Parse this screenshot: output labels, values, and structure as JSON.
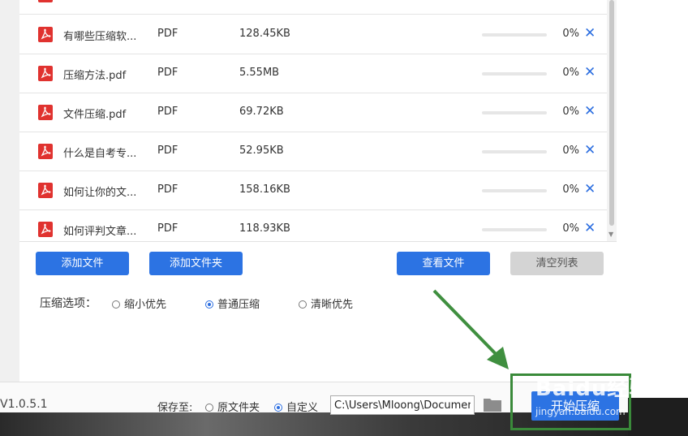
{
  "files": [
    {
      "name": "有哪些压缩软...",
      "type": "PDF",
      "size": "128.45KB",
      "progress": 0,
      "percent": "0%"
    },
    {
      "name": "压缩方法.pdf",
      "type": "PDF",
      "size": "5.55MB",
      "progress": 0,
      "percent": "0%"
    },
    {
      "name": "文件压缩.pdf",
      "type": "PDF",
      "size": "69.72KB",
      "progress": 0,
      "percent": "0%"
    },
    {
      "name": "什么是自考专...",
      "type": "PDF",
      "size": "52.95KB",
      "progress": 0,
      "percent": "0%"
    },
    {
      "name": "如何让你的文...",
      "type": "PDF",
      "size": "158.16KB",
      "progress": 0,
      "percent": "0%"
    },
    {
      "name": "如何评判文章...",
      "type": "PDF",
      "size": "118.93KB",
      "progress": 0,
      "percent": "0%"
    }
  ],
  "delete_glyph": "✕",
  "buttons": {
    "add_file": "添加文件",
    "add_folder": "添加文件夹",
    "view_files": "查看文件",
    "clear_list": "清空列表",
    "start": "开始压缩"
  },
  "compress": {
    "label": "压缩选项：",
    "options": [
      "缩小优先",
      "普通压缩",
      "清晰优先"
    ],
    "selected": "普通压缩"
  },
  "footer": {
    "version": "V1.0.5.1",
    "save_label": "保存至:",
    "save_options": [
      "原文件夹",
      "自定义"
    ],
    "selected": "自定义",
    "path": "C:\\Users\\Mloong\\Documents"
  },
  "watermark": {
    "main": "Baidu经验",
    "sub": "jingyan.baidu.com"
  },
  "colors": {
    "accent": "#2c73e3",
    "pdf_red": "#e0322f",
    "highlight": "#3a8a3a"
  }
}
